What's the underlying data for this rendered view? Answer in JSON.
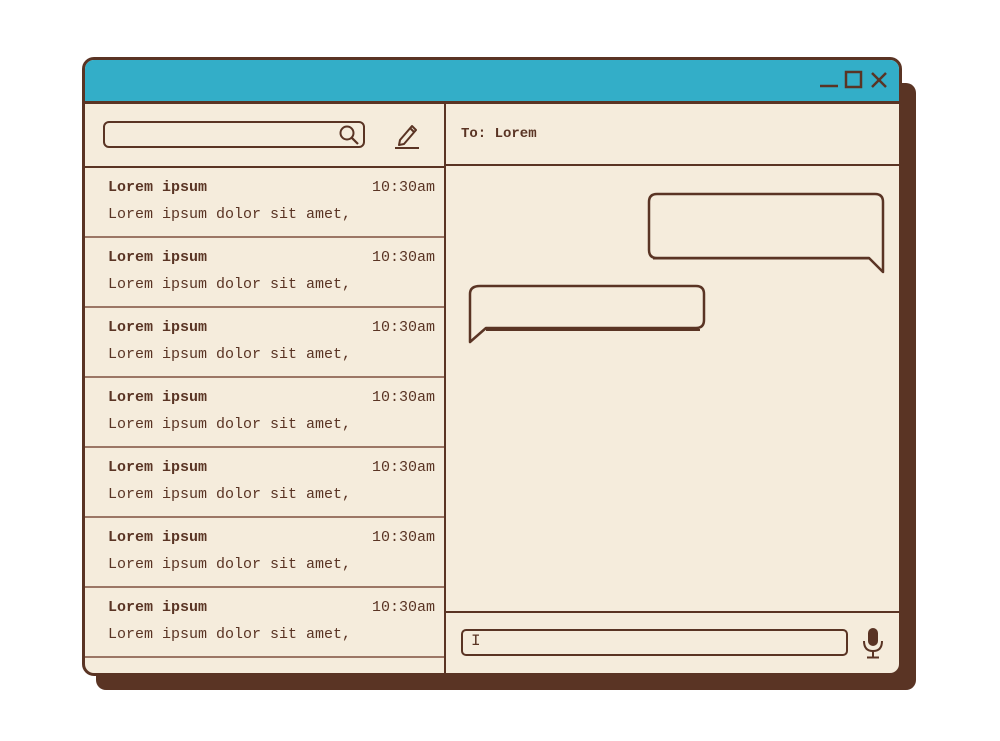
{
  "window": {
    "controls": [
      "minimize-icon",
      "maximize-icon",
      "close-icon"
    ],
    "titlebar_color": "#33aec8",
    "frame_color": "#5a3424",
    "background_color": "#f5ecdc"
  },
  "sidebar": {
    "search": {
      "value": "",
      "placeholder": "",
      "icon": "search-icon"
    },
    "compose_icon": "pencil-icon",
    "conversations": [
      {
        "name": "Lorem ipsum",
        "time": "10:30am",
        "preview": "Lorem ipsum dolor sit amet,"
      },
      {
        "name": "Lorem ipsum",
        "time": "10:30am",
        "preview": "Lorem ipsum dolor sit amet,"
      },
      {
        "name": "Lorem ipsum",
        "time": "10:30am",
        "preview": "Lorem ipsum dolor sit amet,"
      },
      {
        "name": "Lorem ipsum",
        "time": "10:30am",
        "preview": "Lorem ipsum dolor sit amet,"
      },
      {
        "name": "Lorem ipsum",
        "time": "10:30am",
        "preview": "Lorem ipsum dolor sit amet,"
      },
      {
        "name": "Lorem ipsum",
        "time": "10:30am",
        "preview": "Lorem ipsum dolor sit amet,"
      },
      {
        "name": "Lorem ipsum",
        "time": "10:30am",
        "preview": "Lorem ipsum dolor sit amet,"
      }
    ]
  },
  "chat": {
    "to_label": "To: Lorem",
    "messages": [
      {
        "direction": "outgoing",
        "text": ""
      },
      {
        "direction": "incoming",
        "text": ""
      }
    ],
    "composer": {
      "value": "",
      "placeholder": "",
      "cursor_glyph": "I",
      "mic_icon": "microphone-icon"
    }
  }
}
